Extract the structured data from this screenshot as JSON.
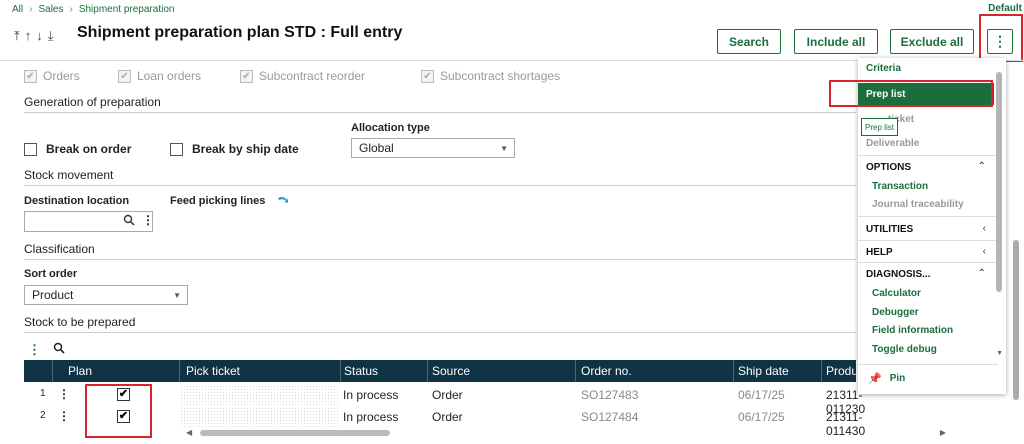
{
  "breadcrumb": [
    "All",
    "Sales",
    "Shipment preparation"
  ],
  "default_label": "Default",
  "title": "Shipment preparation plan STD : Full entry",
  "toolbar": {
    "search": "Search",
    "include_all": "Include all",
    "exclude_all": "Exclude all",
    "more": "⋮"
  },
  "checkboxes": [
    "Orders",
    "Loan orders",
    "Subcontract reorder",
    "Subcontract shortages"
  ],
  "generation": {
    "title": "Generation of preparation",
    "break_on_order": "Break on order",
    "break_by_ship_date": "Break by ship date",
    "allocation_label": "Allocation type",
    "allocation_value": "Global"
  },
  "stock_movement": {
    "title": "Stock movement",
    "destination_label": "Destination location",
    "feed_picking_label": "Feed picking lines"
  },
  "classification": {
    "title": "Classification",
    "sort_label": "Sort order",
    "sort_value": "Product"
  },
  "stock_to_prepare": {
    "title": "Stock to be prepared"
  },
  "table": {
    "columns": [
      "Plan",
      "Pick ticket",
      "Status",
      "Source",
      "Order no.",
      "Ship date",
      "Produ"
    ],
    "rows": [
      {
        "num": "1",
        "status": "In process",
        "source": "Order",
        "order": "SO127483",
        "ship": "06/17/25",
        "product": "21311-011230",
        "checked": "✔"
      },
      {
        "num": "2",
        "status": "In process",
        "source": "Order",
        "order": "SO127484",
        "ship": "06/17/25",
        "product": "21311-011430",
        "checked": "✔"
      }
    ]
  },
  "menu": {
    "criteria": "Criteria",
    "prep_list": "Prep list",
    "tooltip": "Prep list",
    "faded1": "ticket",
    "faded2": "Deliverable",
    "options": "OPTIONS",
    "transaction": "Transaction",
    "journal": "Journal traceability",
    "utilities": "UTILITIES",
    "help": "HELP",
    "diagnosis": "DIAGNOSIS...",
    "calculator": "Calculator",
    "debugger": "Debugger",
    "field_info": "Field information",
    "toggle_debug": "Toggle debug",
    "pin": "Pin"
  },
  "colors": {
    "accent": "#1b6e3c",
    "header_dark": "#0f3345",
    "highlight_red": "#d9262a"
  }
}
